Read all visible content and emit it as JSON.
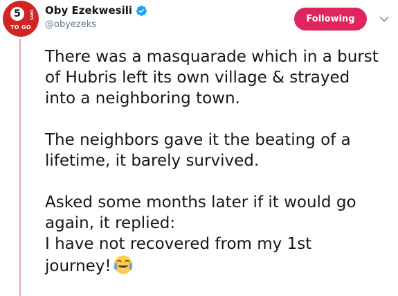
{
  "author": {
    "display_name": "Oby Ezekwesili",
    "handle": "@obyezeks",
    "verified": true,
    "avatar": {
      "number": "5",
      "side_text": "DAYS",
      "bottom_text": "TO GO",
      "color": "#d32424"
    }
  },
  "follow_button": {
    "label": "Following",
    "color": "#e0245e"
  },
  "menu_icon": "chevron-down-icon",
  "tweet": {
    "paragraphs": [
      {
        "lines": [
          "There was a masquarade which in a burst",
          "of Hubris left its own village & strayed",
          "into a neighboring town."
        ]
      },
      {
        "lines": [
          "The neighbors gave it the beating of a",
          "lifetime, it barely survived."
        ]
      },
      {
        "lines": [
          "Asked some months later if it would go",
          "again, it replied:",
          "I have not recovered from my 1st",
          "journey!"
        ]
      }
    ],
    "trailing_emoji": "face-with-tears-of-joy"
  },
  "colors": {
    "text": "#14171a",
    "secondary_text": "#657786",
    "verified_badge": "#1da1f2",
    "thread_line": "#e3a8b6"
  }
}
